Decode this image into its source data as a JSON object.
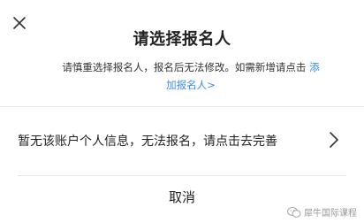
{
  "dialog": {
    "title": "请选择报名人",
    "description": "请慎重选择报名人，报名后无法修改。如需新增请点击 ",
    "add_link": "添加报名人>",
    "notice": "暂无该账户个人信息，无法报名，请点击去完善",
    "cancel_label": "取消"
  },
  "icons": {
    "close": "close-icon",
    "chevron": "chevron-right-icon",
    "watermark": "wechat-icon"
  },
  "watermark": {
    "text": "犀牛国际课程"
  },
  "colors": {
    "link": "#3a8ee6",
    "divider": "#e6e6e6",
    "text": "#222222"
  }
}
